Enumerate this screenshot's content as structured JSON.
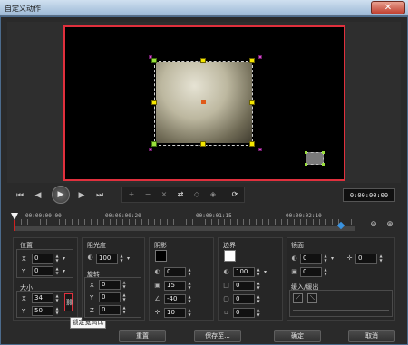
{
  "window": {
    "title": "自定义动作",
    "close_glyph": "✕"
  },
  "preview": {
    "border_color": "#e0303d",
    "handle_color": "#f4e600",
    "anchor_color": "#9adf3b"
  },
  "transport": {
    "buttons": [
      "to-start",
      "prev-frame",
      "play",
      "next-frame",
      "to-end"
    ],
    "glyphs": [
      "⏮",
      "◀",
      "▶",
      "▶",
      "⏭"
    ],
    "tool_icons": [
      "+",
      "−",
      "×",
      "⇄",
      "◇",
      "◈",
      "⟳"
    ],
    "timecode": "0:00:00:00"
  },
  "timeline": {
    "labels": [
      "00:00:00:00",
      "00:00:00:20",
      "00:00:01:15",
      "00:00:02:10"
    ],
    "zoom_out_glyph": "⊖",
    "zoom_in_glyph": "⊕"
  },
  "position": {
    "label": "位置",
    "x_label": "X",
    "x_value": "0",
    "y_label": "Y",
    "y_value": "0"
  },
  "size": {
    "label": "大小",
    "x_label": "X",
    "x_value": "34",
    "y_label": "Y",
    "y_value": "50",
    "lock_tooltip": "锁定宽高比"
  },
  "opacity": {
    "label": "阻光度",
    "value": "100"
  },
  "rotation": {
    "label": "旋转",
    "x_label": "X",
    "x_value": "0",
    "y_label": "Y",
    "y_value": "0",
    "z_label": "Z",
    "z_value": "0"
  },
  "shadow": {
    "label": "阴影",
    "color": "#000000",
    "opacity_value": "0",
    "blur_value": "15",
    "angle_value": "-40",
    "distance_value": "10"
  },
  "border": {
    "label": "边界",
    "color": "#ffffff",
    "opacity_value": "100",
    "width_value": "0",
    "blur_value": "0",
    "softness_value": "0"
  },
  "mirror": {
    "label": "镜面",
    "opacity_value": "0",
    "distance_value": "0",
    "position_value": "0"
  },
  "fade": {
    "label": "缓入/缓出"
  },
  "footer": {
    "reset": "重置",
    "save_as": "保存至...",
    "ok": "确定",
    "cancel": "取消"
  }
}
